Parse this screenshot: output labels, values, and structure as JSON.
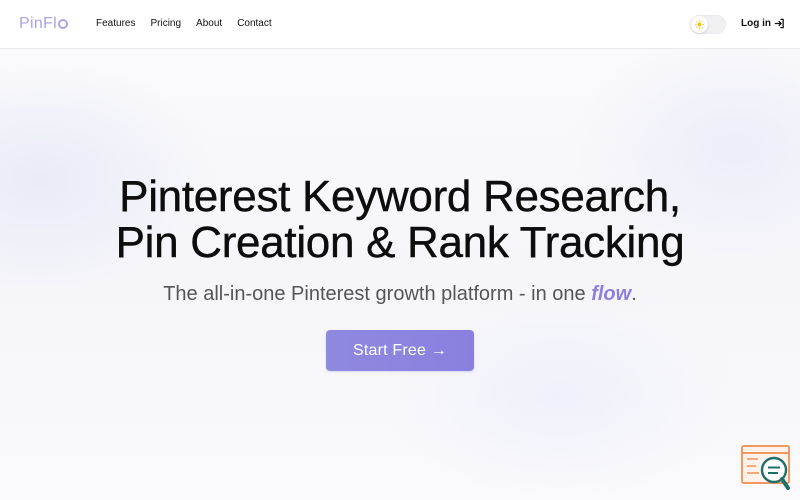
{
  "navbar": {
    "logo_text": "PinFl",
    "links": [
      "Features",
      "Pricing",
      "About",
      "Contact"
    ],
    "theme_icon": "sun-icon",
    "login_label": "Log in",
    "login_icon": "login-arrow-icon"
  },
  "hero": {
    "title_line1": "Pinterest Keyword Research,",
    "title_line2": "Pin Creation & Rank Tracking",
    "subtitle_before": "The all-in-one Pinterest growth platform - in one ",
    "subtitle_flow": "flow",
    "subtitle_after": ".",
    "cta_label": "Start Free →"
  },
  "widgets": {
    "chat_icon": "chat-search-icon"
  },
  "colors": {
    "accent": "#8a7fdf",
    "logo": "#a9a5e4",
    "widget_orange": "#ef8b4b",
    "widget_teal": "#1f6f6b"
  }
}
